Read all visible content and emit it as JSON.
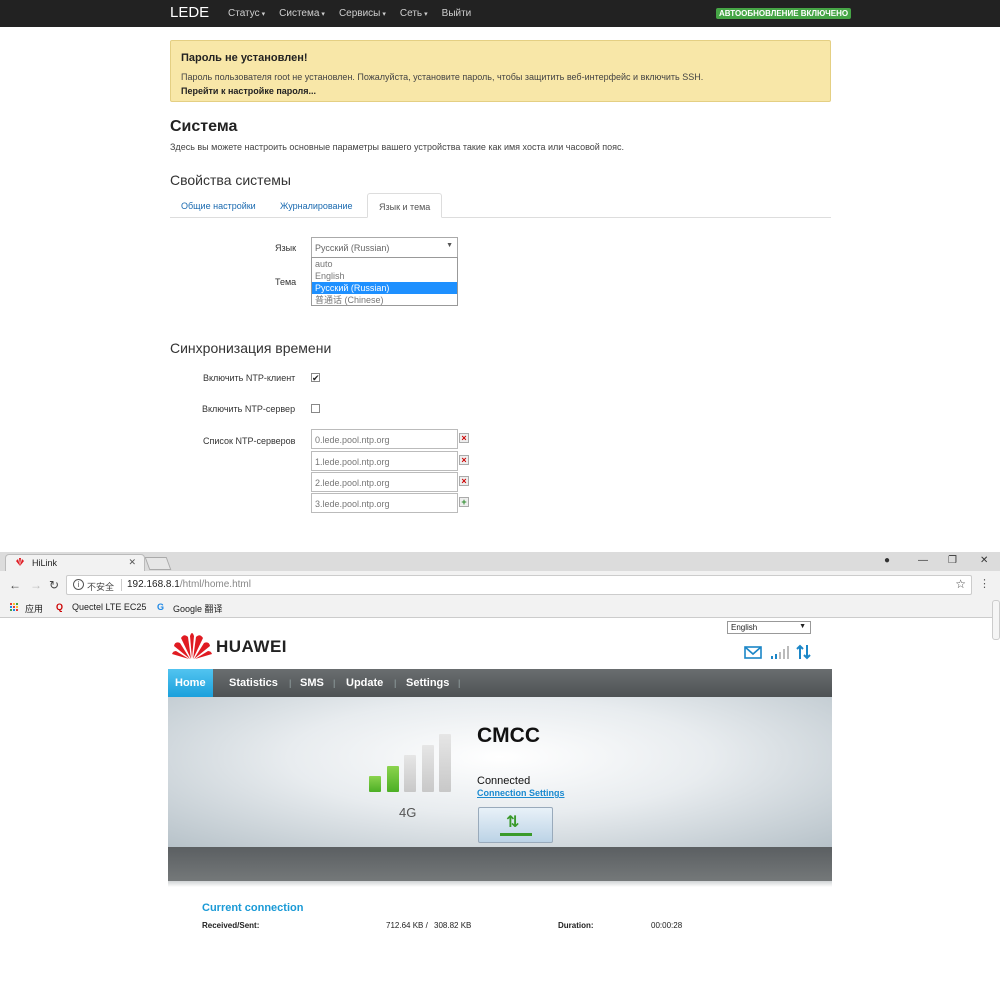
{
  "lede": {
    "brand": "LEDE",
    "menu": [
      "Статус",
      "Система",
      "Сервисы",
      "Сеть",
      "Выйти"
    ],
    "autoupdate_badge": "АВТООБНОВЛЕНИЕ ВКЛЮЧЕНО",
    "alert": {
      "title": "Пароль не установлен!",
      "text": "Пароль пользователя root не установлен. Пожалуйста, установите пароль, чтобы защитить веб-интерфейс и включить SSH.",
      "link": "Перейти к настройке пароля..."
    },
    "page_title": "Система",
    "page_desc": "Здесь вы можете настроить основные параметры вашего устройства такие как имя хоста или часовой пояс.",
    "section_props": "Свойства системы",
    "tabs": [
      "Общие настройки",
      "Журналирование",
      "Язык и тема"
    ],
    "active_tab": "Язык и тема",
    "language_label": "Язык",
    "theme_label": "Тема",
    "language_selected": "Русский (Russian)",
    "language_options": [
      "auto",
      "English",
      "Русский (Russian)",
      "普通话 (Chinese)"
    ],
    "section_sync": "Синхронизация времени",
    "ntp_client_label": "Включить NTP-клиент",
    "ntp_client_checked": true,
    "ntp_server_label": "Включить NTP-сервер",
    "ntp_server_checked": false,
    "ntp_list_label": "Список NTP-серверов",
    "ntp_servers": [
      "0.lede.pool.ntp.org",
      "1.lede.pool.ntp.org",
      "2.lede.pool.ntp.org",
      "3.lede.pool.ntp.org"
    ]
  },
  "browser": {
    "tab_title": "HiLink",
    "insecure_label": "不安全",
    "url_host": "192.168.8.1",
    "url_path": "/html/home.html",
    "bookmarks": [
      "应用",
      "Quectel LTE EC25",
      "Google 翻译"
    ]
  },
  "hilink": {
    "language": "English",
    "brand": "HUAWEI",
    "nav": [
      "Home",
      "Statistics",
      "SMS",
      "Update",
      "Settings"
    ],
    "active_nav": "Home",
    "carrier": "CMCC",
    "network_type": "4G",
    "signal_level": 2,
    "signal_max": 5,
    "status": "Connected",
    "connection_settings": "Connection Settings",
    "current_connection_title": "Current connection",
    "received_sent_label": "Received/Sent:",
    "received": "712.64 KB /",
    "sent": "308.82 KB",
    "duration_label": "Duration:",
    "duration": "00:00:28"
  },
  "colors": {
    "lede_nav_bg": "#222222",
    "badge_green": "#46a546",
    "alert_bg": "#f8e7a8",
    "link_blue": "#1a6ab0",
    "select_highlight": "#1e90ff",
    "hilink_active_tab": "#1aa0dc",
    "signal_on": "#4caf25",
    "signal_off": "#c8c8c8"
  }
}
